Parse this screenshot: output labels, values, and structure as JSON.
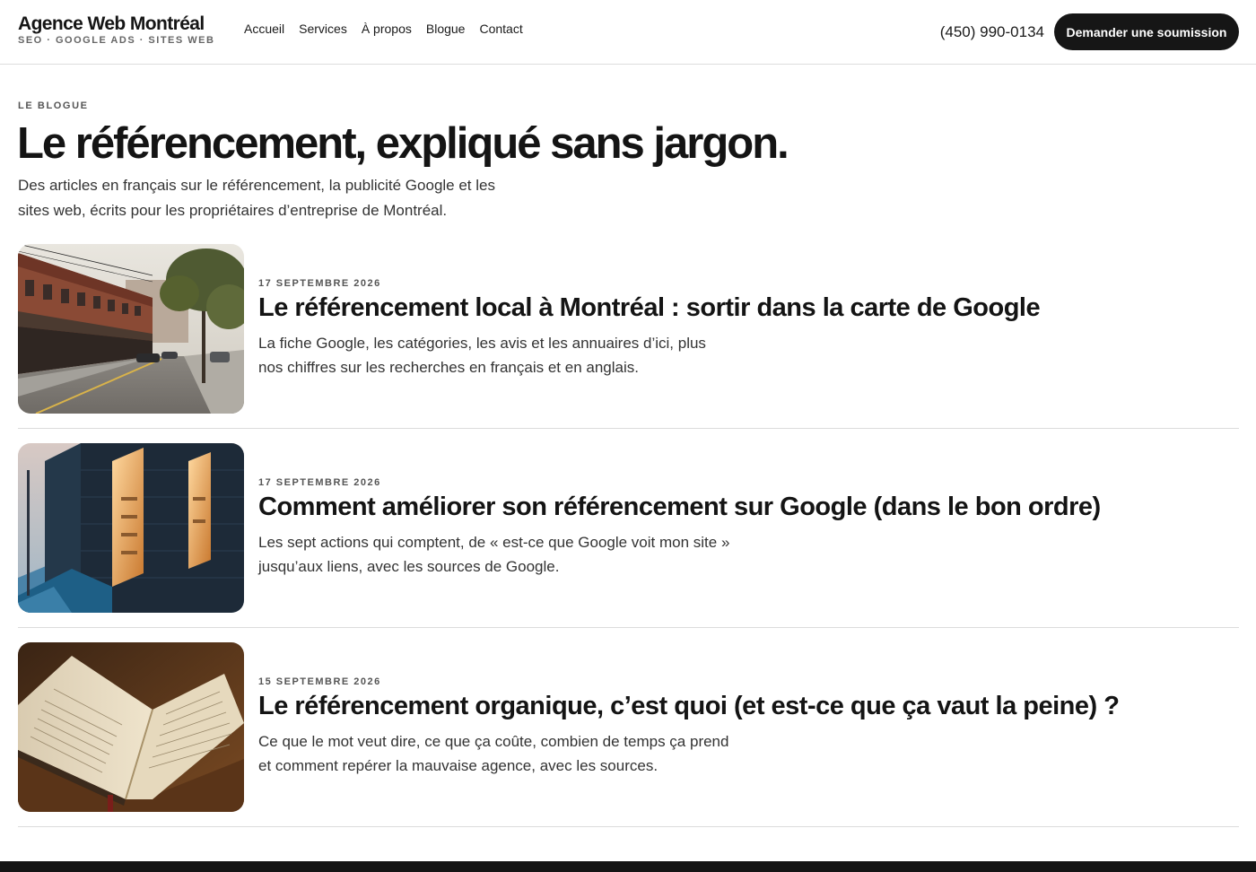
{
  "header": {
    "brand_name": "Agence Web Montréal",
    "brand_tagline": "SEO · GOOGLE ADS · SITES WEB",
    "nav": [
      {
        "label": "Accueil"
      },
      {
        "label": "Services"
      },
      {
        "label": "À propos"
      },
      {
        "label": "Blogue"
      },
      {
        "label": "Contact"
      }
    ],
    "phone": "(450) 990-0134",
    "cta_label": "Demander une soumission"
  },
  "intro": {
    "eyebrow": "LE BLOGUE",
    "title": "Le référencement, expliqué sans jargon.",
    "lead": "Des articles en français sur le référencement, la publicité Google et les sites web, écrits pour les propriétaires d’entreprise de Montréal."
  },
  "articles": [
    {
      "date": "17 SEPTEMBRE 2026",
      "title": "Le référencement local à Montréal : sortir dans la carte de Google",
      "excerpt": "La fiche Google, les catégories, les avis et les annuaires d’ici, plus nos chiffres sur les recherches en français et en anglais.",
      "image_icon": "street-photo"
    },
    {
      "date": "17 SEPTEMBRE 2026",
      "title": "Comment améliorer son référencement sur Google (dans le bon ordre)",
      "excerpt": "Les sept actions qui comptent, de « est-ce que Google voit mon site » jusqu’aux liens, avec les sources de Google.",
      "image_icon": "storefront-photo"
    },
    {
      "date": "15 SEPTEMBRE 2026",
      "title": "Le référencement organique, c’est quoi (et est-ce que ça vaut la peine) ?",
      "excerpt": "Ce que le mot veut dire, ce que ça coûte, combien de temps ça prend et comment repérer la mauvaise agence, avec les sources.",
      "image_icon": "open-book-photo"
    }
  ],
  "colors": {
    "text": "#141414",
    "muted": "#555555",
    "cta_bg": "#161616",
    "divider": "#dcdcdc"
  }
}
